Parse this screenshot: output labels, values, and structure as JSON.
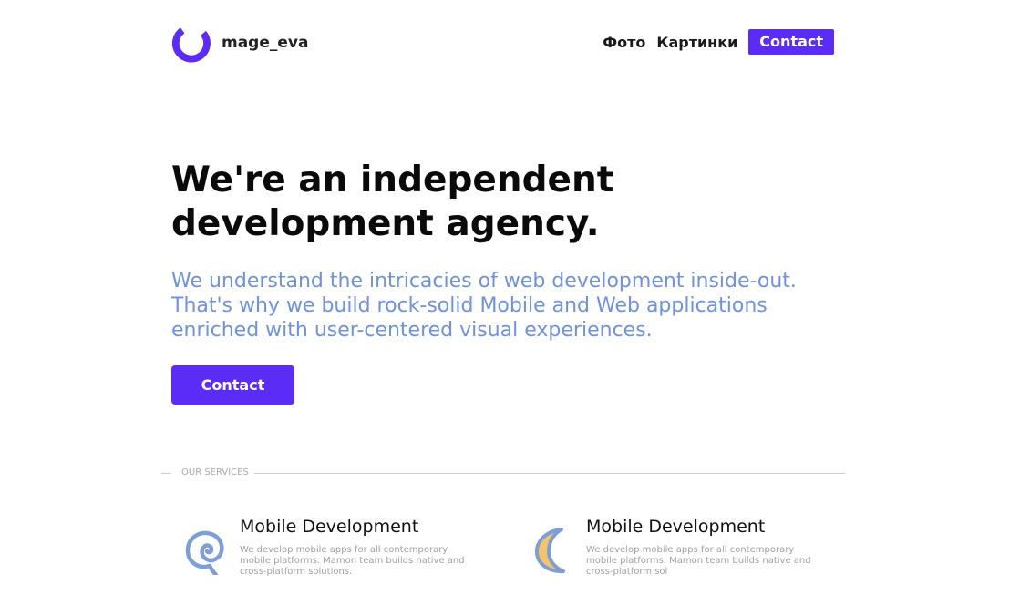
{
  "header": {
    "logo_text": "mage_eva",
    "nav": {
      "foto": "Фото",
      "kartinki": "Картинки",
      "contact": "Contact"
    }
  },
  "hero": {
    "title": "We're an independent development agency.",
    "subtitle": "We understand the intricacies of web development inside-out. That's why we build rock-solid Mobile and Web applications enriched with user-centered visual experiences.",
    "button": "Contact"
  },
  "services": {
    "section_label": "OUR SERVICES",
    "items": [
      {
        "title": "Mobile Development",
        "description": "We develop mobile apps for all contemporary mobile platforms. Mamon team builds native and cross-platform solutions.",
        "icon": "spiral-icon"
      },
      {
        "title": "Mobile Development",
        "description": "We develop mobile apps for all contemporary mobile platforms. Mamon team builds native and cross-platform sol",
        "icon": "crescent-moon-icon"
      }
    ]
  },
  "colors": {
    "accent": "#5b2cf6",
    "subtitle": "#6f92dc",
    "icon_blue": "#7e9fd6",
    "icon_yellow": "#f3c46b"
  }
}
